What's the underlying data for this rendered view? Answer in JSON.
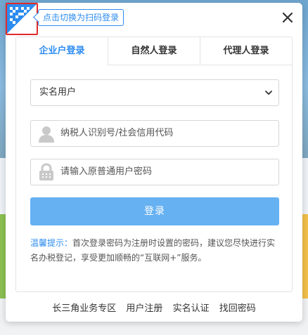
{
  "background": {
    "top_color": "#7aaed6",
    "left_tile_color": "#8cc152",
    "right_tile_color": "#f3c04a"
  },
  "qr_switch": {
    "icon": "qr-code-icon",
    "tooltip": "点击切换为扫码登录"
  },
  "close": {
    "icon": "close-icon"
  },
  "tabs": [
    {
      "label": "企业户登录",
      "active": true
    },
    {
      "label": "自然人登录",
      "active": false
    },
    {
      "label": "代理人登录",
      "active": false
    }
  ],
  "form": {
    "user_type": {
      "selected": "实名用户",
      "icon": "chevron-down-icon"
    },
    "taxpayer_id": {
      "placeholder": "纳税人识别号/社会信用代码",
      "icon": "user-icon"
    },
    "password": {
      "placeholder": "请输入原普通用户密码",
      "icon": "lock-icon"
    },
    "login_label": "登录"
  },
  "tip": {
    "label": "温馨提示：",
    "text": "首次登录密码为注册时设置的密码，建议您尽快进行实名办税登记，享受更加顺畅的“互联网+”服务。"
  },
  "footer_links": [
    "长三角业务专区",
    "用户注册",
    "实名认证",
    "找回密码"
  ],
  "colors": {
    "accent": "#2d8cf0",
    "button": "#66b1f2",
    "highlight_border": "#e02b2b"
  }
}
